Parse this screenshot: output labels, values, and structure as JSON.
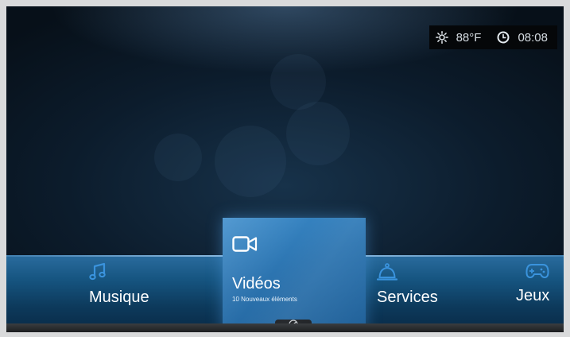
{
  "status": {
    "weather_icon": "sun-icon",
    "temperature": "88°F",
    "clock_icon": "clock-icon",
    "time": "08:08"
  },
  "menu": {
    "items": [
      {
        "label": "Musique",
        "icon": "music-note-icon"
      },
      {
        "label": "Vidéos",
        "icon": "video-camera-icon",
        "subtitle": "10 Nouveaux éléments",
        "selected": true
      },
      {
        "label": "Services",
        "icon": "service-bell-icon"
      },
      {
        "label": "Jeux",
        "icon": "gamepad-icon"
      }
    ],
    "handle_icon": "dashboard-icon"
  },
  "colors": {
    "accent": "#2c74b0",
    "icon_blue": "#3a93dd",
    "menu_bar": "#165581"
  }
}
